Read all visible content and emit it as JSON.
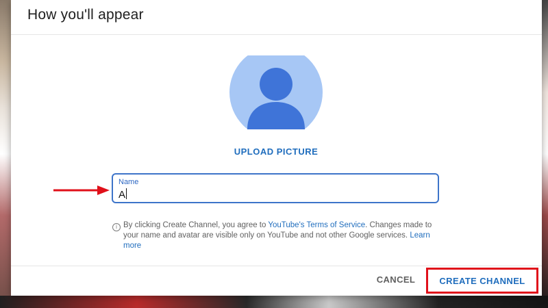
{
  "dialog": {
    "title": "How you'll appear",
    "upload_label": "UPLOAD PICTURE",
    "name_field": {
      "label": "Name",
      "value": "A"
    },
    "disclaimer": {
      "prefix": "By clicking Create Channel, you agree to ",
      "terms_link": "YouTube's Terms of Service",
      "middle": ". Changes made to your name and avatar are visible only on YouTube and not other Google services. ",
      "learn_more": "Learn more"
    },
    "cancel_label": "CANCEL",
    "create_label": "CREATE CHANNEL"
  },
  "icons": {
    "avatar": "default-avatar-icon",
    "info": "info-icon",
    "annotation_arrow": "red-arrow-icon"
  },
  "colors": {
    "accent_blue": "#1f6dbd",
    "field_border": "#3d74c9",
    "highlight_red": "#e0101a",
    "avatar_bg": "#a7c7f5",
    "avatar_fg": "#3f74d8"
  }
}
